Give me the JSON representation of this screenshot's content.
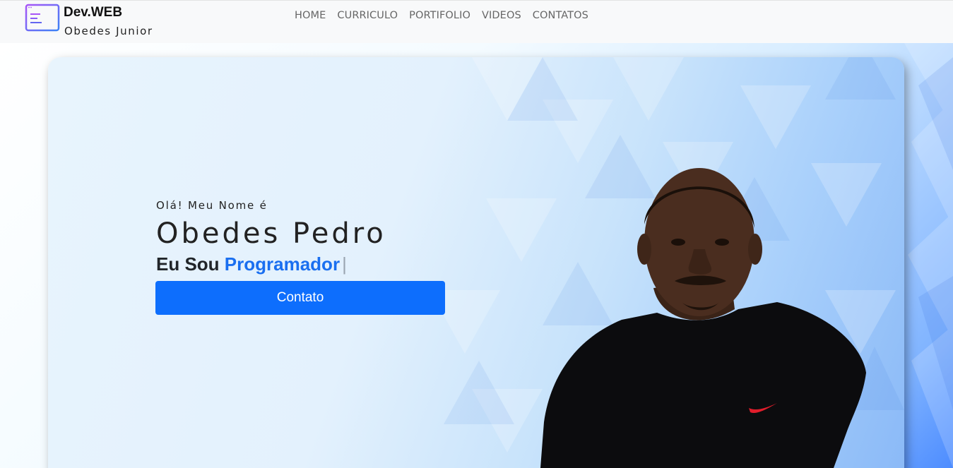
{
  "brand": {
    "title": "Dev.WEB",
    "subtitle": "Obedes Junior",
    "icon": "code-window-icon"
  },
  "nav": {
    "items": [
      {
        "label": "HOME"
      },
      {
        "label": "CURRICULO"
      },
      {
        "label": "PORTIFOLIO"
      },
      {
        "label": "VIDEOS"
      },
      {
        "label": "CONTATOS"
      }
    ]
  },
  "hero": {
    "greeting": "Olá! Meu Nome é",
    "name": "Obedes Pedro",
    "role_prefix": "Eu Sou",
    "role_word": "Programador",
    "cursor": "|",
    "button_label": "Contato",
    "photo": "profile-photo"
  },
  "colors": {
    "primary": "#0d6efd",
    "accent_text": "#1a6ff0",
    "navbar_bg": "#f8f9fa",
    "hero_blue": "#4d8cff"
  }
}
